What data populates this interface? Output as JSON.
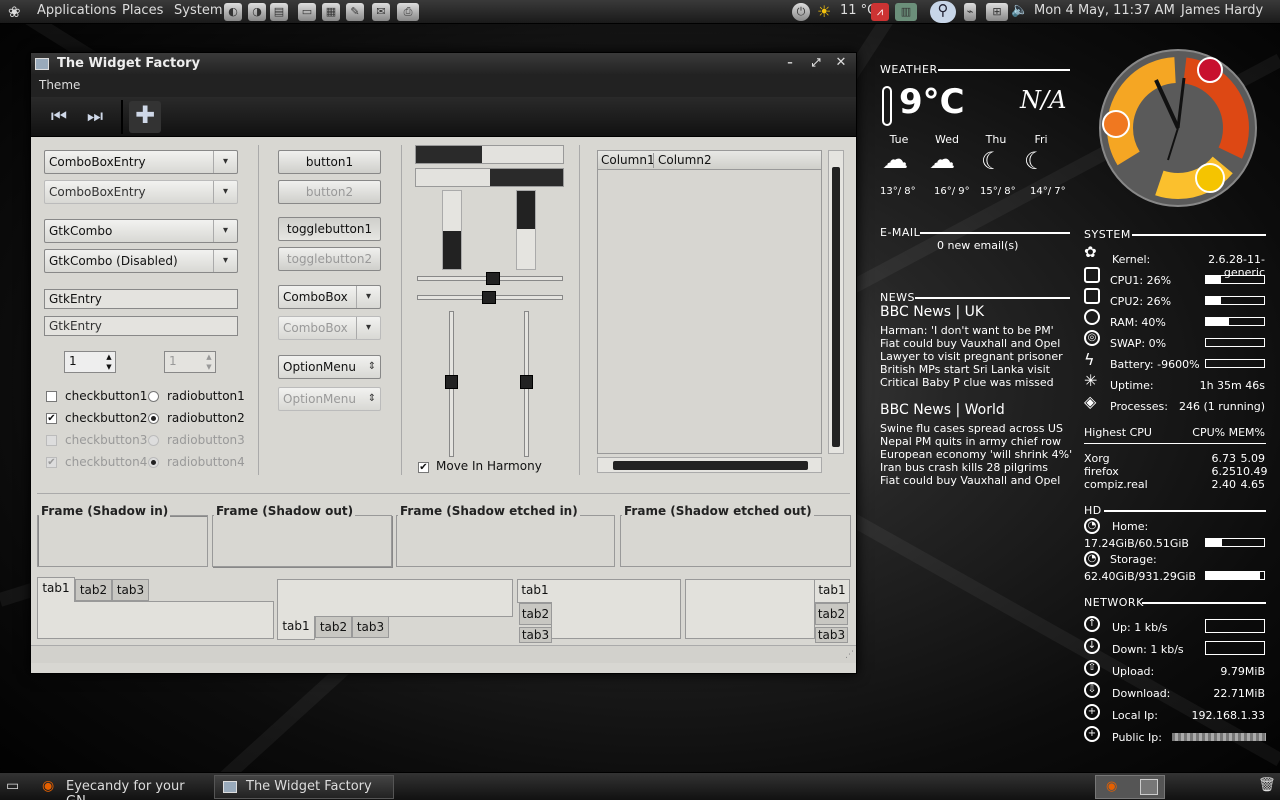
{
  "top_panel": {
    "menus": [
      "Applications",
      "Places",
      "System"
    ],
    "temp": "11 °C",
    "clock": "Mon  4 May, 11:37 AM",
    "user": "James Hardy"
  },
  "window": {
    "title": "The Widget Factory",
    "menu": "Theme",
    "col1": {
      "combo1": "ComboBoxEntry",
      "combo2": "ComboBoxEntry",
      "gtkcombo": "GtkCombo",
      "gtkcombo_dis": "GtkCombo (Disabled)",
      "entry1": "GtkEntry",
      "entry2": "GtkEntry",
      "spin1": "1",
      "spin2": "1",
      "checks": [
        "checkbutton1",
        "checkbutton2",
        "checkbutton3",
        "checkbutton4"
      ],
      "radios": [
        "radiobutton1",
        "radiobutton2",
        "radiobutton3",
        "radiobutton4"
      ]
    },
    "col2": {
      "button1": "button1",
      "button2": "button2",
      "toggle1": "togglebutton1",
      "toggle2": "togglebutton2",
      "combobox1": "ComboBox",
      "combobox2": "ComboBox",
      "option1": "OptionMenu",
      "option2": "OptionMenu"
    },
    "col3": {
      "harmony": "Move In Harmony",
      "progress1": 0.45,
      "progress2": 0.5
    },
    "list": {
      "columns": [
        "Column1",
        "Column2"
      ]
    },
    "frames": [
      "Frame (Shadow in)",
      "Frame (Shadow out)",
      "Frame (Shadow etched in)",
      "Frame (Shadow etched out)"
    ],
    "tabs": [
      "tab1",
      "tab2",
      "tab3"
    ]
  },
  "conky": {
    "weather": {
      "label": "WEATHER",
      "temp": "9°C",
      "cond": "N/A",
      "days": [
        {
          "day": "Tue",
          "temp": "13°/ 8°"
        },
        {
          "day": "Wed",
          "temp": "16°/ 9°"
        },
        {
          "day": "Thu",
          "temp": "15°/ 8°"
        },
        {
          "day": "Fri",
          "temp": "14°/ 7°"
        }
      ]
    },
    "email": {
      "label": "E-MAIL",
      "text": "0 new email(s)"
    },
    "news": {
      "label": "NEWS",
      "uk_title": "BBC News | UK",
      "uk": [
        "Harman: 'I don't want to be PM'",
        "Fiat could buy Vauxhall and Opel",
        "Lawyer to visit pregnant prisoner",
        "British MPs start Sri Lanka visit",
        "Critical Baby P clue was missed"
      ],
      "world_title": "BBC News | World",
      "world": [
        "Swine flu cases spread across US",
        "Nepal PM quits in army chief row",
        "European economy 'will shrink 4%'",
        "Iran bus crash kills 28 pilgrims",
        "Fiat could buy Vauxhall and Opel"
      ]
    },
    "system": {
      "label": "SYSTEM",
      "rows": [
        {
          "k": "Kernel:",
          "v": "2.6.28-11-generic"
        },
        {
          "k": "CPU1: 26%",
          "bar": 0.26
        },
        {
          "k": "CPU2: 26%",
          "bar": 0.26
        },
        {
          "k": "RAM: 40%",
          "bar": 0.4
        },
        {
          "k": "SWAP: 0%",
          "bar": 0
        },
        {
          "k": "Battery: -9600%",
          "bar": 0
        },
        {
          "k": "Uptime:",
          "v": "1h 35m 46s"
        },
        {
          "k": "Processes:",
          "v": "246 (1 running)"
        }
      ],
      "highest_cpu": "Highest CPU",
      "cpu_mem": "CPU% MEM%",
      "procs": [
        {
          "n": "Xorg",
          "c": "6.73",
          "m": "5.09"
        },
        {
          "n": "firefox",
          "c": "6.25",
          "m": "10.49"
        },
        {
          "n": "compiz.real",
          "c": "2.40",
          "m": "4.65"
        }
      ]
    },
    "hd": {
      "label": "HD",
      "home": "Home:",
      "home_v": "17.24GiB/60.51GiB",
      "home_bar": 0.28,
      "storage": "Storage:",
      "storage_v": "62.40GiB/931.29GiB",
      "storage_bar": 0.93
    },
    "network": {
      "label": "NETWORK",
      "up": "Up: 1 kb/s",
      "down": "Down: 1 kb/s",
      "upload": "Upload:",
      "upload_v": "9.79MiB",
      "download": "Download:",
      "download_v": "22.71MiB",
      "local": "Local Ip:",
      "local_v": "192.168.1.33",
      "public": "Public Ip:"
    }
  },
  "taskbar": {
    "tasks": [
      "Eyecandy for your GN...",
      "The Widget Factory"
    ]
  }
}
